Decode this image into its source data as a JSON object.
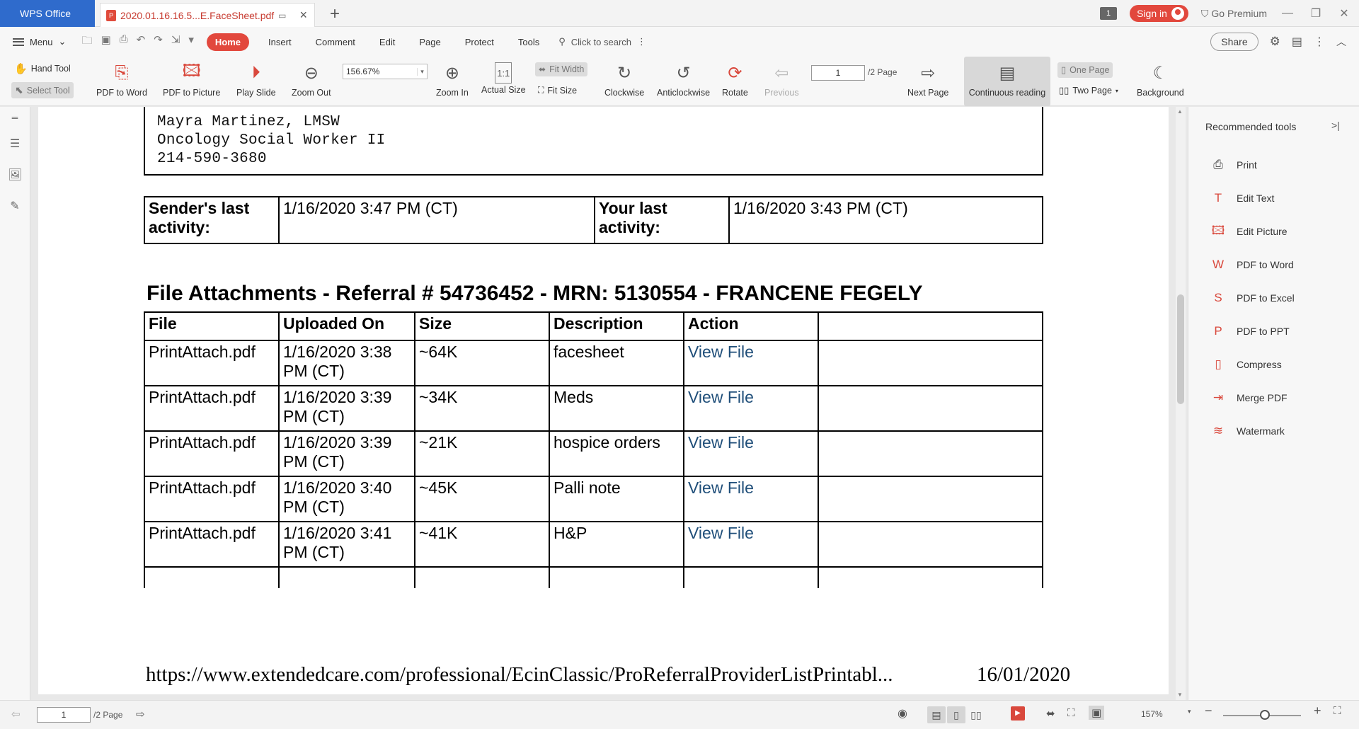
{
  "titlebar": {
    "app_name": "WPS Office",
    "doc_tab": "2020.01.16.16.5...E.FaceSheet.pdf",
    "new_tab": "+",
    "notif_count": "1",
    "sign_in": "Sign in",
    "go_premium": "Go Premium"
  },
  "menubar": {
    "menu": "Menu",
    "tabs": [
      "Home",
      "Insert",
      "Comment",
      "Edit",
      "Page",
      "Protect",
      "Tools"
    ],
    "search": "Click to search",
    "share": "Share"
  },
  "ribbon": {
    "hand_tool": "Hand Tool",
    "select_tool": "Select Tool",
    "pdf_to_word": "PDF to Word",
    "pdf_to_picture": "PDF to Picture",
    "play_slide": "Play Slide",
    "zoom_out": "Zoom Out",
    "zoom_value": "156.67%",
    "zoom_in": "Zoom In",
    "actual_size": "Actual Size",
    "fit_width": "Fit Width",
    "fit_size": "Fit Size",
    "clockwise": "Clockwise",
    "anticlockwise": "Anticlockwise",
    "rotate": "Rotate",
    "previous": "Previous",
    "page_current": "1",
    "page_total": "/2 Page",
    "next_page": "Next Page",
    "continuous_reading": "Continuous reading",
    "one_page": "One Page",
    "two_page": "Two Page",
    "background": "Background"
  },
  "document": {
    "signature": [
      "Mayra Martinez, LMSW",
      "Oncology Social Worker II",
      "214-590-3680"
    ],
    "activity": {
      "sender_label": "Sender's last activity:",
      "sender_value": "1/16/2020 3:47 PM (CT)",
      "your_label": "Your last activity:",
      "your_value": "1/16/2020 3:43 PM (CT)"
    },
    "attachments_title": "File Attachments - Referral # 54736452 - MRN: 5130554 - FRANCENE FEGELY",
    "columns": [
      "File",
      "Uploaded On",
      "Size",
      "Description",
      "Action",
      ""
    ],
    "rows": [
      {
        "file": "PrintAttach.pdf",
        "uploaded": "1/16/2020 3:38 PM (CT)",
        "size": "~64K",
        "description": "facesheet",
        "action": "View File"
      },
      {
        "file": "PrintAttach.pdf",
        "uploaded": "1/16/2020 3:39 PM (CT)",
        "size": "~34K",
        "description": "Meds",
        "action": "View File"
      },
      {
        "file": "PrintAttach.pdf",
        "uploaded": "1/16/2020 3:39 PM (CT)",
        "size": "~21K",
        "description": "hospice orders",
        "action": "View File"
      },
      {
        "file": "PrintAttach.pdf",
        "uploaded": "1/16/2020 3:40 PM (CT)",
        "size": "~45K",
        "description": "Palli note",
        "action": "View File"
      },
      {
        "file": "PrintAttach.pdf",
        "uploaded": "1/16/2020 3:41 PM (CT)",
        "size": "~41K",
        "description": "H&P",
        "action": "View File"
      }
    ],
    "footer_url": "https://www.extendedcare.com/professional/EcinClassic/ProReferralProviderListPrintabl...",
    "footer_date": "16/01/2020"
  },
  "right_panel": {
    "title": "Recommended tools",
    "items": [
      {
        "label": "Print",
        "icon": "printer-icon"
      },
      {
        "label": "Edit Text",
        "icon": "edit-text-icon"
      },
      {
        "label": "Edit Picture",
        "icon": "edit-picture-icon"
      },
      {
        "label": "PDF to Word",
        "icon": "pdf-to-word-icon"
      },
      {
        "label": "PDF to Excel",
        "icon": "pdf-to-excel-icon"
      },
      {
        "label": "PDF to PPT",
        "icon": "pdf-to-ppt-icon"
      },
      {
        "label": "Compress",
        "icon": "compress-icon"
      },
      {
        "label": "Merge PDF",
        "icon": "merge-pdf-icon"
      },
      {
        "label": "Watermark",
        "icon": "watermark-icon"
      }
    ]
  },
  "statusbar": {
    "page_current": "1",
    "page_total": "/2 Page",
    "zoom": "157%"
  }
}
